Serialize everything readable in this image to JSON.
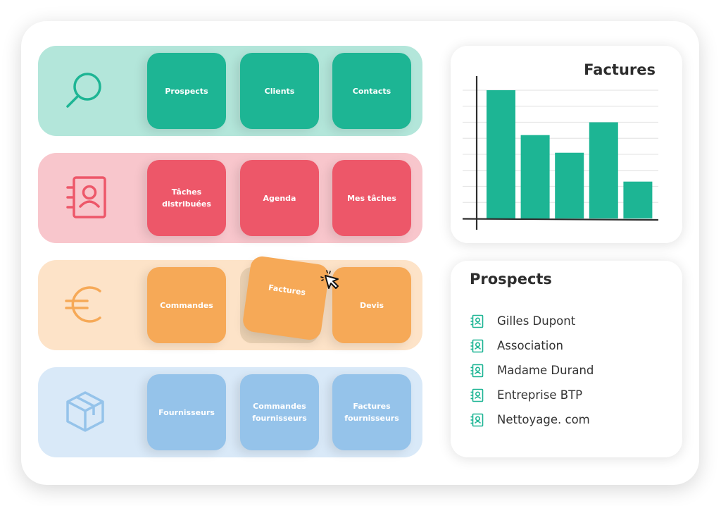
{
  "colors": {
    "green": "#1db594",
    "green_bg": "#b3e6da",
    "red": "#ed5769",
    "red_bg": "#f8c6cc",
    "orange": "#f6a957",
    "orange_bg": "#fde3c8",
    "blue": "#95c3ea",
    "blue_bg": "#d9e9f8",
    "text_dark": "#2d2d2d"
  },
  "rows": [
    {
      "icon": "search-icon",
      "tiles": [
        "Prospects",
        "Clients",
        "Contacts"
      ]
    },
    {
      "icon": "contact-book-icon",
      "tiles": [
        "Tâches distribuées",
        "Agenda",
        "Mes tâches"
      ]
    },
    {
      "icon": "euro-icon",
      "tiles": [
        "Commandes",
        "Factures",
        "Devis"
      ],
      "dragging_tile": "Factures"
    },
    {
      "icon": "package-icon",
      "tiles": [
        "Fournisseurs",
        "Commandes fournisseurs",
        "Factures fournisseurs"
      ]
    }
  ],
  "chart_card": {
    "title": "Factures"
  },
  "chart_data": {
    "type": "bar",
    "title": "Factures",
    "categories": [
      "",
      "",
      "",
      "",
      ""
    ],
    "values": [
      8,
      5.2,
      4.1,
      6,
      2.3
    ],
    "xlabel": "",
    "ylabel": "",
    "ylim": [
      0,
      8
    ],
    "grid": true,
    "bar_color": "#1db594"
  },
  "prospects_card": {
    "title": "Prospects",
    "items": [
      "Gilles Dupont",
      "Association",
      "Madame Durand",
      "Entreprise BTP",
      "Nettoyage. com"
    ]
  }
}
